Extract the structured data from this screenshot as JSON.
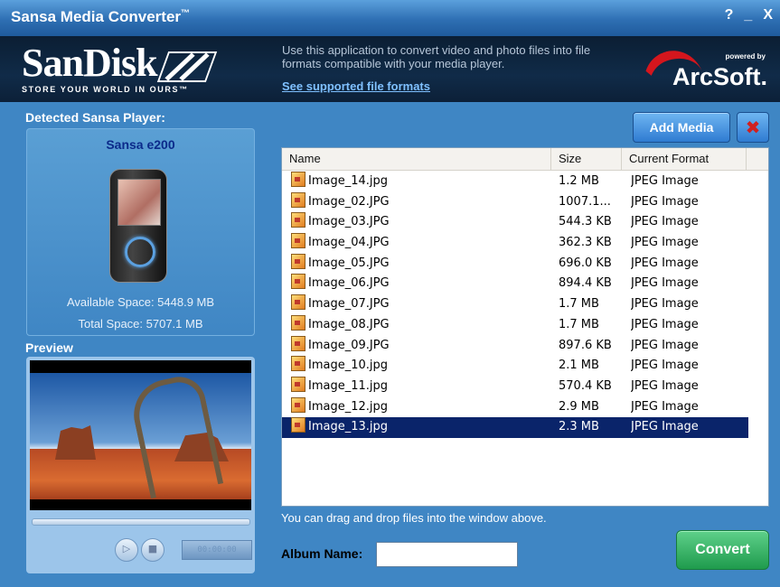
{
  "window": {
    "title": "Sansa Media Converter",
    "title_mark": "™",
    "buttons": {
      "help": "?",
      "minimize": "_",
      "close": "X"
    }
  },
  "banner": {
    "sandisk_logo": "SanDisk",
    "sandisk_tagline": "STORE YOUR WORLD IN OURS™",
    "description": "Use this application to convert video and photo files into file formats compatible with your media player.",
    "link": "See supported file formats",
    "powered_by": "powered by",
    "arcsoft_logo": "ArcSoft."
  },
  "player": {
    "section_label": "Detected Sansa Player:",
    "name": "Sansa e200",
    "available_space": "Available Space:   5448.9 MB",
    "total_space": "Total Space:   5707.1 MB"
  },
  "preview": {
    "section_label": "Preview",
    "timer": "00:00:00"
  },
  "toolbar": {
    "add_media": "Add Media",
    "remove_icon": "✖"
  },
  "file_list": {
    "columns": [
      "Name",
      "Size",
      "Current Format"
    ],
    "rows": [
      {
        "name": "Image_14.jpg",
        "size": "1.2 MB",
        "format": "JPEG Image"
      },
      {
        "name": "Image_02.JPG",
        "size": "1007.1...",
        "format": "JPEG Image"
      },
      {
        "name": "Image_03.JPG",
        "size": "544.3 KB",
        "format": "JPEG Image"
      },
      {
        "name": "Image_04.JPG",
        "size": "362.3 KB",
        "format": "JPEG Image"
      },
      {
        "name": "Image_05.JPG",
        "size": "696.0 KB",
        "format": "JPEG Image"
      },
      {
        "name": "Image_06.JPG",
        "size": "894.4 KB",
        "format": "JPEG Image"
      },
      {
        "name": "Image_07.JPG",
        "size": "1.7 MB",
        "format": "JPEG Image"
      },
      {
        "name": "Image_08.JPG",
        "size": "1.7 MB",
        "format": "JPEG Image"
      },
      {
        "name": "Image_09.JPG",
        "size": "897.6 KB",
        "format": "JPEG Image"
      },
      {
        "name": "Image_10.jpg",
        "size": "2.1 MB",
        "format": "JPEG Image"
      },
      {
        "name": "Image_11.jpg",
        "size": "570.4 KB",
        "format": "JPEG Image"
      },
      {
        "name": "Image_12.jpg",
        "size": "2.9 MB",
        "format": "JPEG Image"
      },
      {
        "name": "Image_13.jpg",
        "size": "2.3 MB",
        "format": "JPEG Image",
        "selected": true
      }
    ]
  },
  "footer": {
    "drag_hint": "You can drag and drop files into the window above.",
    "album_label": "Album Name:",
    "album_value": "",
    "convert": "Convert"
  },
  "colors": {
    "window_bg": "#3f86c4",
    "banner_bg": "#102b48",
    "selected_row": "#0a246a",
    "convert_button": "#2fae5e",
    "add_media_button": "#3a8be0"
  }
}
